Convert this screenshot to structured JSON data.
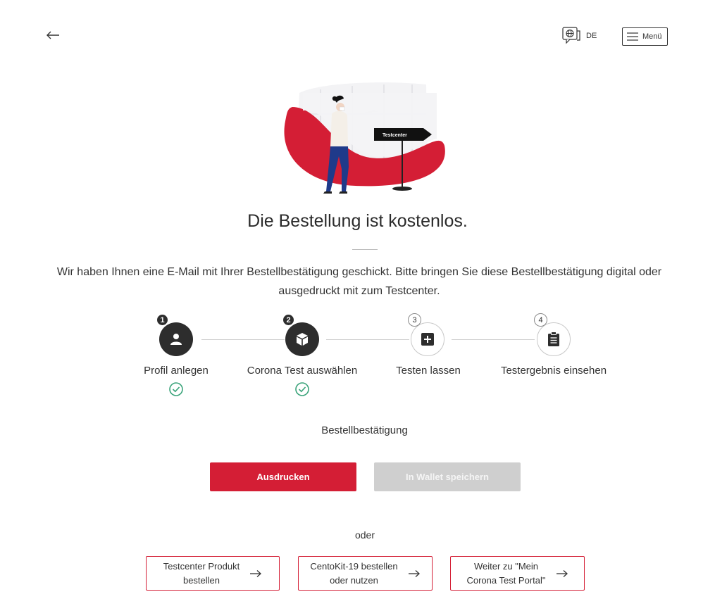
{
  "header": {
    "back_icon": "arrow-left-icon",
    "language_icon": "globe-chat-icon",
    "language": "DE",
    "menu_icon": "hamburger-icon",
    "menu_label": "Menü"
  },
  "illustration": {
    "sign_text": "Testcenter"
  },
  "content": {
    "title": "Die Bestellung ist kostenlos.",
    "description": "Wir haben Ihnen eine E-Mail mit Ihrer Bestellbestätigung geschickt. Bitte bringen Sie diese Bestellbestätigung digital oder ausgedruckt mit zum Testcenter."
  },
  "steps": [
    {
      "number": "1",
      "label": "Profil anlegen",
      "icon": "person-icon",
      "completed": true
    },
    {
      "number": "2",
      "label": "Corona Test auswählen",
      "icon": "box-icon",
      "completed": true
    },
    {
      "number": "3",
      "label": "Testen lassen",
      "icon": "plus-square-icon",
      "completed": false
    },
    {
      "number": "4",
      "label": "Testergebnis einsehen",
      "icon": "clipboard-icon",
      "completed": false
    }
  ],
  "confirmation": {
    "heading": "Bestellbestätigung",
    "print_label": "Ausdrucken",
    "wallet_label": "In Wallet speichern"
  },
  "alternatives": {
    "separator": "oder",
    "links": [
      {
        "line1": "Testcenter Produkt",
        "line2": "bestellen"
      },
      {
        "line1": "CentoKit-19 bestellen",
        "line2": "oder nutzen"
      },
      {
        "line1": "Weiter zu \"Mein",
        "line2": "Corona Test Portal\""
      }
    ]
  },
  "colors": {
    "brand_red": "#d41e35",
    "check_green": "#3aa37a",
    "dark": "#2d2d2d",
    "disabled": "#cfcfcf"
  }
}
